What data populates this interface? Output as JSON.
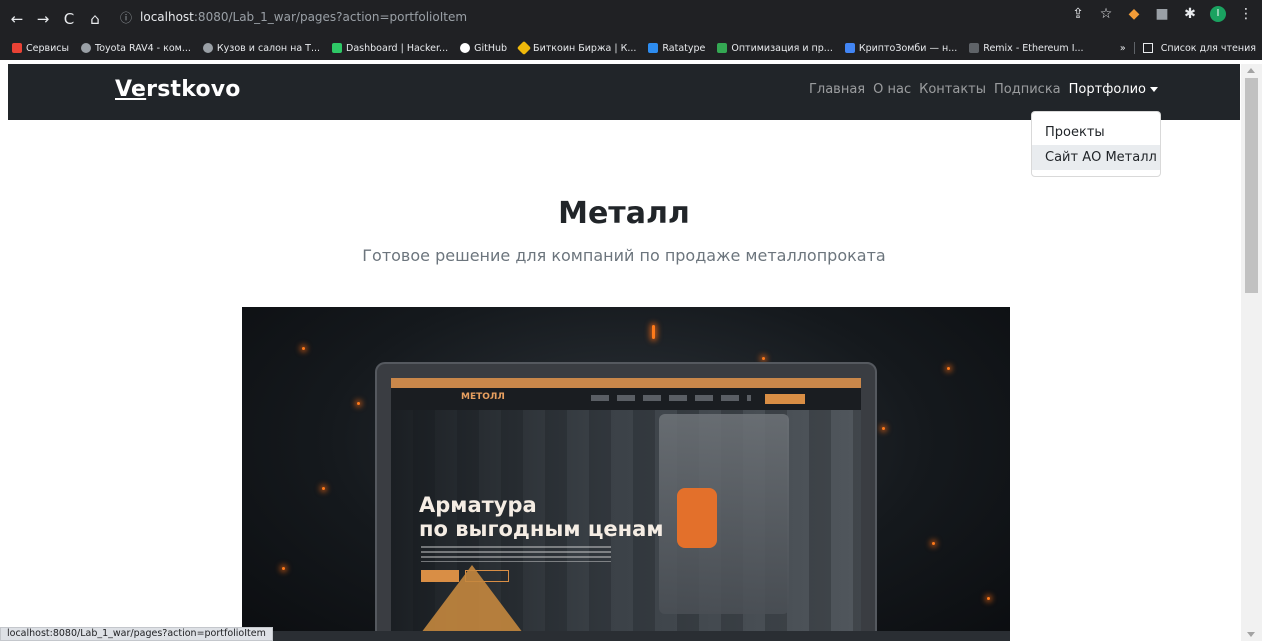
{
  "browser": {
    "url_host": "localhost",
    "url_path": ":8080/Lab_1_war/pages?action=portfolioItem",
    "bookmarks": [
      {
        "label": "Сервисы",
        "color": "#e94235"
      },
      {
        "label": "Toyota RAV4 - ком...",
        "color": "#9aa0a6"
      },
      {
        "label": "Кузов и салон на Т...",
        "color": "#9aa0a6"
      },
      {
        "label": "Dashboard | Hacker...",
        "color": "#2ec866"
      },
      {
        "label": "GitHub",
        "color": "#ffffff"
      },
      {
        "label": "Биткоин Биржа | К...",
        "color": "#f0b90b"
      },
      {
        "label": "Ratatype",
        "color": "#2d8cf0"
      },
      {
        "label": "Оптимизация и пр...",
        "color": "#34a853"
      },
      {
        "label": "КриптоЗомби — н...",
        "color": "#4285f4"
      },
      {
        "label": "Remix - Ethereum I...",
        "color": "#5f6368"
      }
    ],
    "reading_list": "Список для чтения",
    "more": "»"
  },
  "site": {
    "brand_underlined": "Ve",
    "brand_rest": "rstkovo",
    "nav": [
      {
        "label": "Главная"
      },
      {
        "label": "О нас"
      },
      {
        "label": "Контакты"
      },
      {
        "label": "Подписка"
      },
      {
        "label": "Портфолио"
      }
    ],
    "dropdown": [
      {
        "label": "Проекты"
      },
      {
        "label": "Сайт АО Металл"
      }
    ]
  },
  "main": {
    "title": "Металл",
    "subtitle": "Готовое решение для компаний по продаже металлопроката",
    "preview": {
      "logo": "МЕТОЛЛ",
      "headline_1": "Арматура",
      "headline_2": "по выгодным ценам"
    }
  },
  "status_bar": "localhost:8080/Lab_1_war/pages?action=portfolioItem"
}
